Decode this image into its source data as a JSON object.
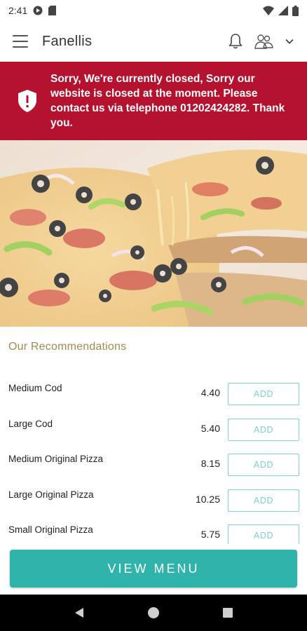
{
  "status_bar": {
    "time": "2:41",
    "icons": [
      "media-icon",
      "sim-icon",
      "wifi-icon",
      "signal-icon",
      "battery-icon"
    ]
  },
  "app_bar": {
    "title": "Fanellis",
    "icons": [
      "menu-icon",
      "bell-icon",
      "user-icon",
      "chevron-down-icon"
    ]
  },
  "banner": {
    "icon": "shield-alert-icon",
    "message": "Sorry, We're currently closed, Sorry our website is closed at the moment. Please contact us via telephone 01202424282. Thank you.",
    "color": "#b5122f"
  },
  "recommendations": {
    "title": "Our Recommendations",
    "add_label": "ADD",
    "items": [
      {
        "name": "Medium Cod",
        "price": "4.40"
      },
      {
        "name": "Large Cod",
        "price": "5.40"
      },
      {
        "name": "Medium Original Pizza",
        "price": "8.15"
      },
      {
        "name": "Large Original Pizza",
        "price": "10.25"
      },
      {
        "name": "Small Original Pizza",
        "price": "5.75"
      }
    ]
  },
  "view_menu": {
    "label": "VIEW MENU",
    "color": "#2fb3ab"
  },
  "nav_bar": {
    "icons": [
      "back-icon",
      "home-icon",
      "recents-icon"
    ]
  },
  "colors": {
    "accent": "#2fb3ab",
    "add_border": "#7dd1cb",
    "heading_gold": "#a48a4f"
  }
}
